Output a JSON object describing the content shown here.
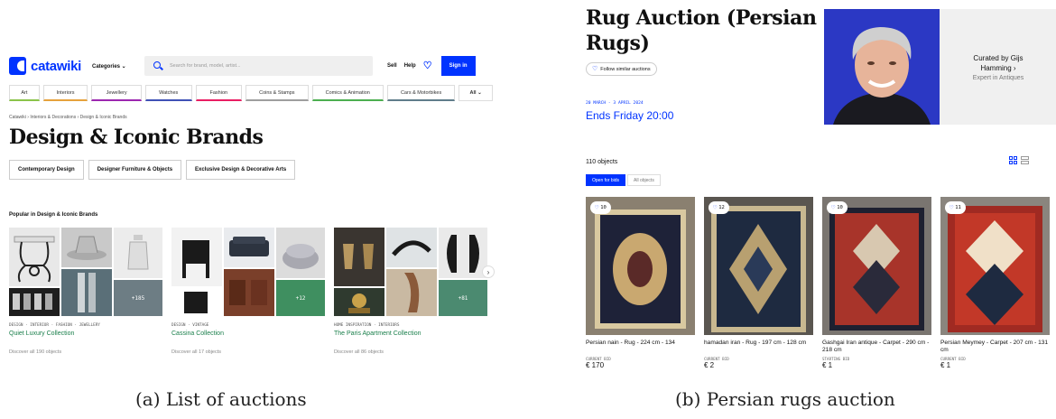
{
  "panel_a": {
    "logo_text": "catawiki",
    "categories_button": "Categories ⌄",
    "search_placeholder": "Search for brand, model, artist...",
    "sell": "Sell",
    "help": "Help",
    "sign_in": "Sign in",
    "category_tabs": [
      {
        "label": "Art",
        "color": "#8bc34a"
      },
      {
        "label": "Interiors",
        "color": "#e6a23c"
      },
      {
        "label": "Jewellery",
        "color": "#9c27b0"
      },
      {
        "label": "Watches",
        "color": "#3f51b5"
      },
      {
        "label": "Fashion",
        "color": "#e91e63"
      },
      {
        "label": "Coins & Stamps",
        "color": "#9e9e9e"
      },
      {
        "label": "Comics & Animation",
        "color": "#4caf50"
      },
      {
        "label": "Cars & Motorbikes",
        "color": "#607d8b"
      }
    ],
    "all_label": "All ⌄",
    "breadcrumb": "Catawiki  ›  Interiors & Decorations  ›  Design & Iconic Brands",
    "page_title": "Design & Iconic Brands",
    "subcategories": [
      "Contemporary Design",
      "Designer Furniture & Objects",
      "Exclusive Design & Decorative Arts"
    ],
    "popular_heading": "Popular in Design & Iconic Brands",
    "collections": [
      {
        "tags": "DESIGN · INTERIOR · FASHION · JEWELLERY",
        "title": "Quiet Luxury Collection",
        "more": "+185",
        "discover": "Discover all 190 objects"
      },
      {
        "tags": "DESIGN · VINTAGE",
        "title": "Cassina Collection",
        "more": "+12",
        "discover": "Discover all 17 objects"
      },
      {
        "tags": "HOME INSPIRATION · INTERIORS",
        "title": "The Paris Apartment Collection",
        "more": "+81",
        "discover": "Discover all 86 objects"
      }
    ],
    "caption": "(a) List of auctions"
  },
  "panel_b": {
    "title": "Rug Auction (Persian Rugs)",
    "follow": "Follow similar auctions",
    "dates": "20 MARCH - 3 APRIL 2024",
    "ends": "Ends Friday 20:00",
    "curated_by": "Curated by Gijs Hamming ›",
    "expert": "Expert in Antiques",
    "objects_count": "110 objects",
    "filter_open": "Open for bids",
    "filter_all": "All objects",
    "lots": [
      {
        "likes": "10",
        "title": "Persian nain - Rug - 224 cm - 134",
        "bid_label": "CURRENT BID",
        "bid": "€ 170"
      },
      {
        "likes": "12",
        "title": "hamadan iran - Rug - 197 cm - 128 cm",
        "bid_label": "CURRENT BID",
        "bid": "€ 2"
      },
      {
        "likes": "10",
        "title": "Gashgai Iran antique - Carpet - 290 cm - 218 cm",
        "bid_label": "STARTING BID",
        "bid": "€ 1"
      },
      {
        "likes": "11",
        "title": "Persian Meymey - Carpet - 207 cm - 131 cm",
        "bid_label": "CURRENT BID",
        "bid": "€ 1"
      }
    ],
    "caption": "(b) Persian rugs auction"
  },
  "colors": {
    "brand_blue": "#0033ff",
    "collection_green": "#1a7f4b"
  }
}
